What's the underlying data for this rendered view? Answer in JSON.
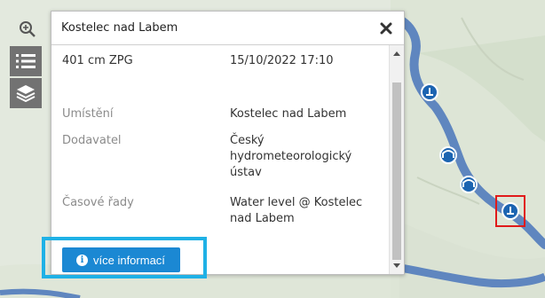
{
  "popup": {
    "title": "Kostelec nad Labem",
    "level": "401 cm ZPG",
    "timestamp": "15/10/2022 17:10",
    "fields": [
      {
        "label": "Umístění",
        "value": "Kostelec nad Labem"
      },
      {
        "label": "Dodavatel",
        "value": "Český hydrometeorologický ústav"
      },
      {
        "label": "Časové řady",
        "value": "Water level @ Kostelec nad Labem"
      }
    ],
    "more_info_label": "více informací"
  },
  "icons": {
    "zoom": "zoom-in-icon",
    "list": "list-icon",
    "layers": "layers-icon",
    "close": "close-icon",
    "info": "info-icon",
    "station": "water-level-station-icon",
    "bridge": "bridge-station-icon"
  },
  "colors": {
    "accent": "#1b88d3",
    "highlight_box": "#1fb1e6",
    "selected_station": "#e01a1a",
    "river": "#5f86bf",
    "station_marker": "#1c64b1"
  }
}
